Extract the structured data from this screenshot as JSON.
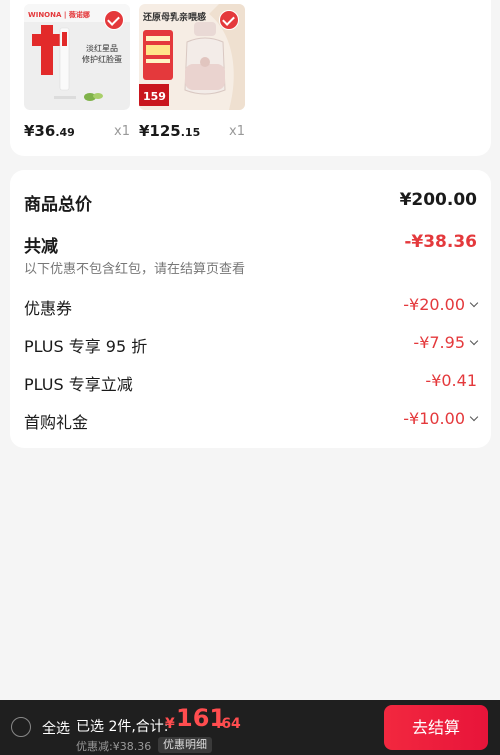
{
  "products": [
    {
      "name": "product-winona",
      "brand_text": "WINONA | 薇诺娜",
      "promo_line1": "淡红星品",
      "promo_line2": "修护红脸蛋",
      "price_int": "¥36",
      "price_dec": ".49",
      "qty": "x1",
      "selected": true
    },
    {
      "name": "product-bottle",
      "banner_text": "还原母乳亲喂感",
      "badge_price": "159",
      "price_int": "¥125",
      "price_dec": ".15",
      "qty": "x1",
      "selected": true
    }
  ],
  "summary": {
    "total_label": "商品总价",
    "total_value": "¥200.00",
    "reduce_label": "共减",
    "reduce_value": "-¥38.36",
    "note": "以下优惠不包含红包，请在结算页查看",
    "items": [
      {
        "label": "优惠券",
        "value": "-¥20.00",
        "expandable": true
      },
      {
        "label": "PLUS 专享 95 折",
        "value": "-¥7.95",
        "expandable": true
      },
      {
        "label": "PLUS 专享立减",
        "value": "-¥0.41",
        "expandable": false
      },
      {
        "label": "首购礼金",
        "value": "-¥10.00",
        "expandable": true
      }
    ]
  },
  "bottom_bar": {
    "select_all": "全选",
    "selected_text": "已选 2件,合计:",
    "currency": "¥",
    "total_int": "161",
    "total_dec": ".64",
    "discount_text": "优惠减:¥38.36",
    "detail_label": "优惠明细",
    "checkout_label": "去结算"
  },
  "colors": {
    "accent_red": "#e4393c",
    "bar_bg": "#1f1f1f",
    "page_bg": "#f5f5f5"
  }
}
